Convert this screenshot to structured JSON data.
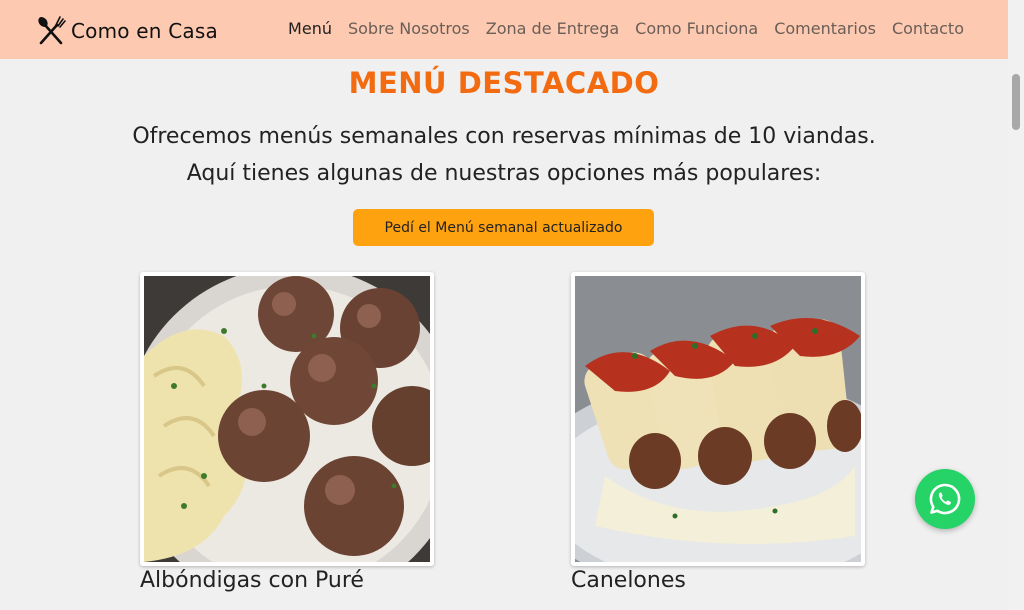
{
  "brand": {
    "name": "Como en Casa",
    "icon": "fork-knife-icon"
  },
  "nav": {
    "items": [
      {
        "label": "Menú",
        "active": true
      },
      {
        "label": "Sobre Nosotros",
        "active": false
      },
      {
        "label": "Zona de Entrega",
        "active": false
      },
      {
        "label": "Como Funciona",
        "active": false
      },
      {
        "label": "Comentarios",
        "active": false
      },
      {
        "label": "Contacto",
        "active": false
      }
    ]
  },
  "menu": {
    "title": "MENÚ DESTACADO",
    "intro_line1": "Ofrecemos menús semanales con reservas mínimas de 10 viandas.",
    "intro_line2": "Aquí tienes algunas de nuestras opciones más populares:",
    "cta_label": "Pedí el Menú semanal actualizado",
    "dishes": [
      {
        "name": "Albóndigas con Puré"
      },
      {
        "name": "Canelones"
      }
    ]
  },
  "floating": {
    "whatsapp_icon": "whatsapp-icon"
  },
  "colors": {
    "navbar": "#fdc9b1",
    "accent": "#f26b10",
    "cta": "#ffa20f",
    "whatsapp": "#25d366",
    "background": "#f0f0f0"
  }
}
